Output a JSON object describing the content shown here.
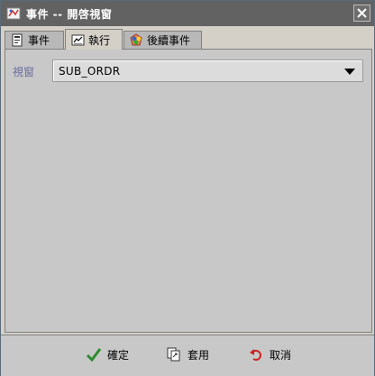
{
  "window": {
    "title": "事件 -- 開啓視窗"
  },
  "tabs": [
    {
      "label": "事件",
      "icon": "event-icon",
      "active": false
    },
    {
      "label": "執行",
      "icon": "execute-icon",
      "active": true
    },
    {
      "label": "後續事件",
      "icon": "follow-up-event-icon",
      "active": false
    }
  ],
  "form": {
    "window_label": "視窗",
    "window_value": "SUB_ORDR"
  },
  "buttons": {
    "ok": "確定",
    "apply": "套用",
    "cancel": "取消"
  },
  "colors": {
    "titlebar": "#626262",
    "panel": "#c8c8c8",
    "label": "#6b6b9c",
    "ok_icon": "#2e8b2e",
    "cancel_icon": "#cc2222"
  }
}
